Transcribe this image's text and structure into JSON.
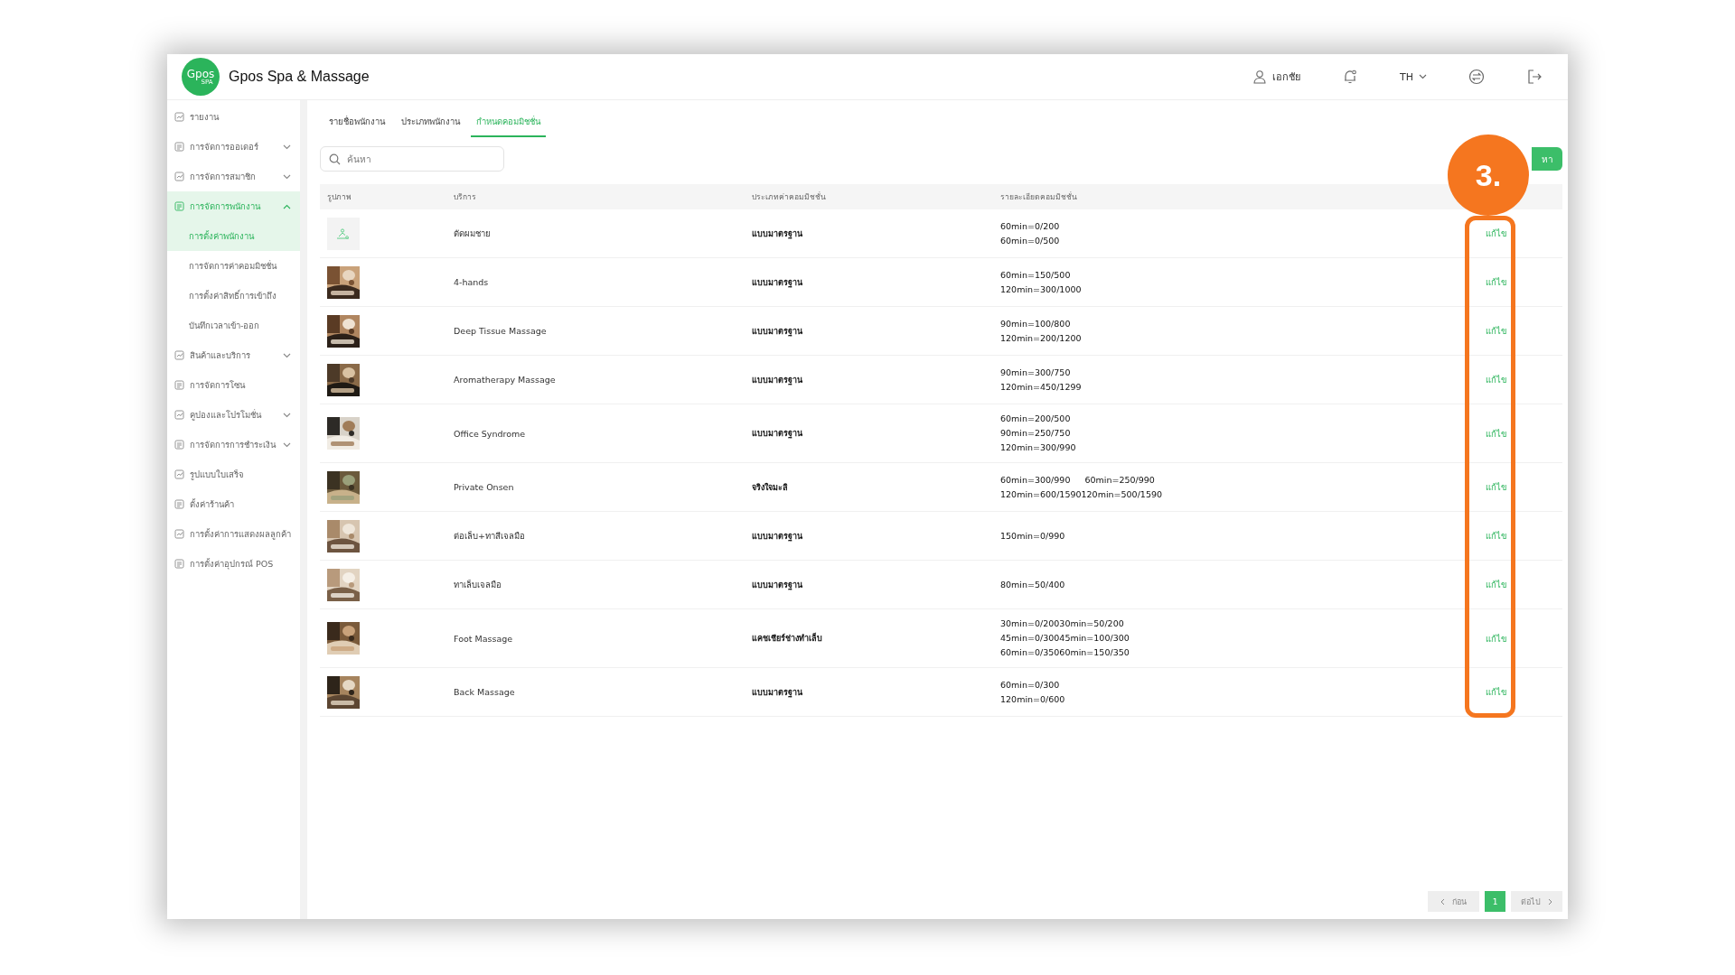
{
  "header": {
    "logo": {
      "main": "Gpos",
      "sub": "SPA"
    },
    "title": "Gpos Spa & Massage",
    "user": "เอกชัย",
    "language": "TH"
  },
  "sidebar": {
    "items": [
      {
        "label": "รายงาน",
        "kind": "link",
        "active": false
      },
      {
        "label": "การจัดการออเดอร์",
        "kind": "group",
        "active": false,
        "expanded": false
      },
      {
        "label": "การจัดการสมาชิก",
        "kind": "group",
        "active": false,
        "expanded": false
      },
      {
        "label": "การจัดการพนักงาน",
        "kind": "group",
        "active": true,
        "expanded": true,
        "children": [
          {
            "label": "การตั้งค่าพนักงาน",
            "selected": true
          },
          {
            "label": "การจัดการค่าคอมมิชชั่น",
            "selected": false
          },
          {
            "label": "การตั้งค่าสิทธิ์การเข้าถึง",
            "selected": false
          },
          {
            "label": "บันทึกเวลาเข้า-ออก",
            "selected": false
          }
        ]
      },
      {
        "label": "สินค้าและบริการ",
        "kind": "group",
        "active": false,
        "expanded": false
      },
      {
        "label": "การจัดการโซน",
        "kind": "link",
        "active": false
      },
      {
        "label": "คูปองและโปรโมชั่น",
        "kind": "group",
        "active": false,
        "expanded": false
      },
      {
        "label": "การจัดการการชำระเงิน",
        "kind": "group",
        "active": false,
        "expanded": false
      },
      {
        "label": "รูปแบบใบเสร็จ",
        "kind": "link",
        "active": false
      },
      {
        "label": "ตั้งค่าร้านค้า",
        "kind": "link",
        "active": false
      },
      {
        "label": "การตั้งค่าการแสดงผลลูกค้า",
        "kind": "link",
        "active": false
      },
      {
        "label": "การตั้งค่าอุปกรณ์ POS",
        "kind": "link",
        "active": false
      }
    ]
  },
  "tabs": [
    {
      "label": "รายชื่อพนักงาน",
      "selected": false
    },
    {
      "label": "ประเภทพนักงาน",
      "selected": false
    },
    {
      "label": "กำหนดคอมมิชชั่น",
      "selected": true
    }
  ],
  "search": {
    "placeholder": "ค้นหา"
  },
  "add_button": {
    "label": "หา"
  },
  "table": {
    "columns": [
      "รูปภาพ",
      "บริการ",
      "ประเภทค่าคอมมิชชั่น",
      "รายละเอียดคอมมิชชั่น"
    ],
    "rows": [
      {
        "kind": "placeholder",
        "service": "ตัดผมชาย",
        "type": "แบบมาตรฐาน",
        "details": [
          [
            "60min=0/200"
          ],
          [
            "60min=0/500"
          ]
        ],
        "action": "แก้ไข"
      },
      {
        "kind": "picture",
        "service": "4-hands",
        "type": "แบบมาตรฐาน",
        "details": [
          [
            "60min=150/500"
          ],
          [
            "120min=300/1000"
          ]
        ],
        "action": "แก้ไข"
      },
      {
        "kind": "picture",
        "service": "Deep Tissue Massage",
        "type": "แบบมาตรฐาน",
        "details": [
          [
            "90min=100/800"
          ],
          [
            "120min=200/1200"
          ]
        ],
        "action": "แก้ไข"
      },
      {
        "kind": "picture",
        "service": "Aromatherapy Massage",
        "type": "แบบมาตรฐาน",
        "details": [
          [
            "90min=300/750"
          ],
          [
            "120min=450/1299"
          ]
        ],
        "action": "แก้ไข"
      },
      {
        "kind": "picture",
        "service": "Office Syndrome",
        "type": "แบบมาตรฐาน",
        "details": [
          [
            "60min=200/500"
          ],
          [
            "90min=250/750"
          ],
          [
            "120min=300/990"
          ]
        ],
        "action": "แก้ไข"
      },
      {
        "kind": "picture",
        "service": "Private Onsen",
        "type": "จริงใจมะลิ",
        "details": [
          [
            "60min=300/990",
            "60min=250/990"
          ],
          [
            "120min=600/1590120min=500/1590"
          ]
        ],
        "action": "แก้ไข"
      },
      {
        "kind": "picture",
        "service": "ต่อเล็บ+ทาสีเจลมือ",
        "type": "แบบมาตรฐาน",
        "details": [
          [
            "150min=0/990"
          ]
        ],
        "action": "แก้ไข"
      },
      {
        "kind": "picture",
        "service": "ทาเล็บเจลมือ",
        "type": "แบบมาตรฐาน",
        "details": [
          [
            "80min=50/400"
          ]
        ],
        "action": "แก้ไข"
      },
      {
        "kind": "picture",
        "service": "Foot Massage",
        "type": "แคชเชียร์ช่างทำเล็บ",
        "details": [
          [
            "30min=0/20030min=50/200"
          ],
          [
            "45min=0/30045min=100/300"
          ],
          [
            "60min=0/35060min=150/350"
          ]
        ],
        "action": "แก้ไข"
      },
      {
        "kind": "picture",
        "service": "Back Massage",
        "type": "แบบมาตรฐาน",
        "details": [
          [
            "60min=0/300"
          ],
          [
            "120min=0/600"
          ]
        ],
        "action": "แก้ไข"
      }
    ]
  },
  "pagination": {
    "previous": {
      "label": "ก่อน",
      "disabled": true
    },
    "pages": [
      {
        "label": "1",
        "selected": true
      }
    ],
    "next": {
      "label": "ต่อไป",
      "disabled": true
    }
  },
  "annotation": {
    "label": "3."
  }
}
